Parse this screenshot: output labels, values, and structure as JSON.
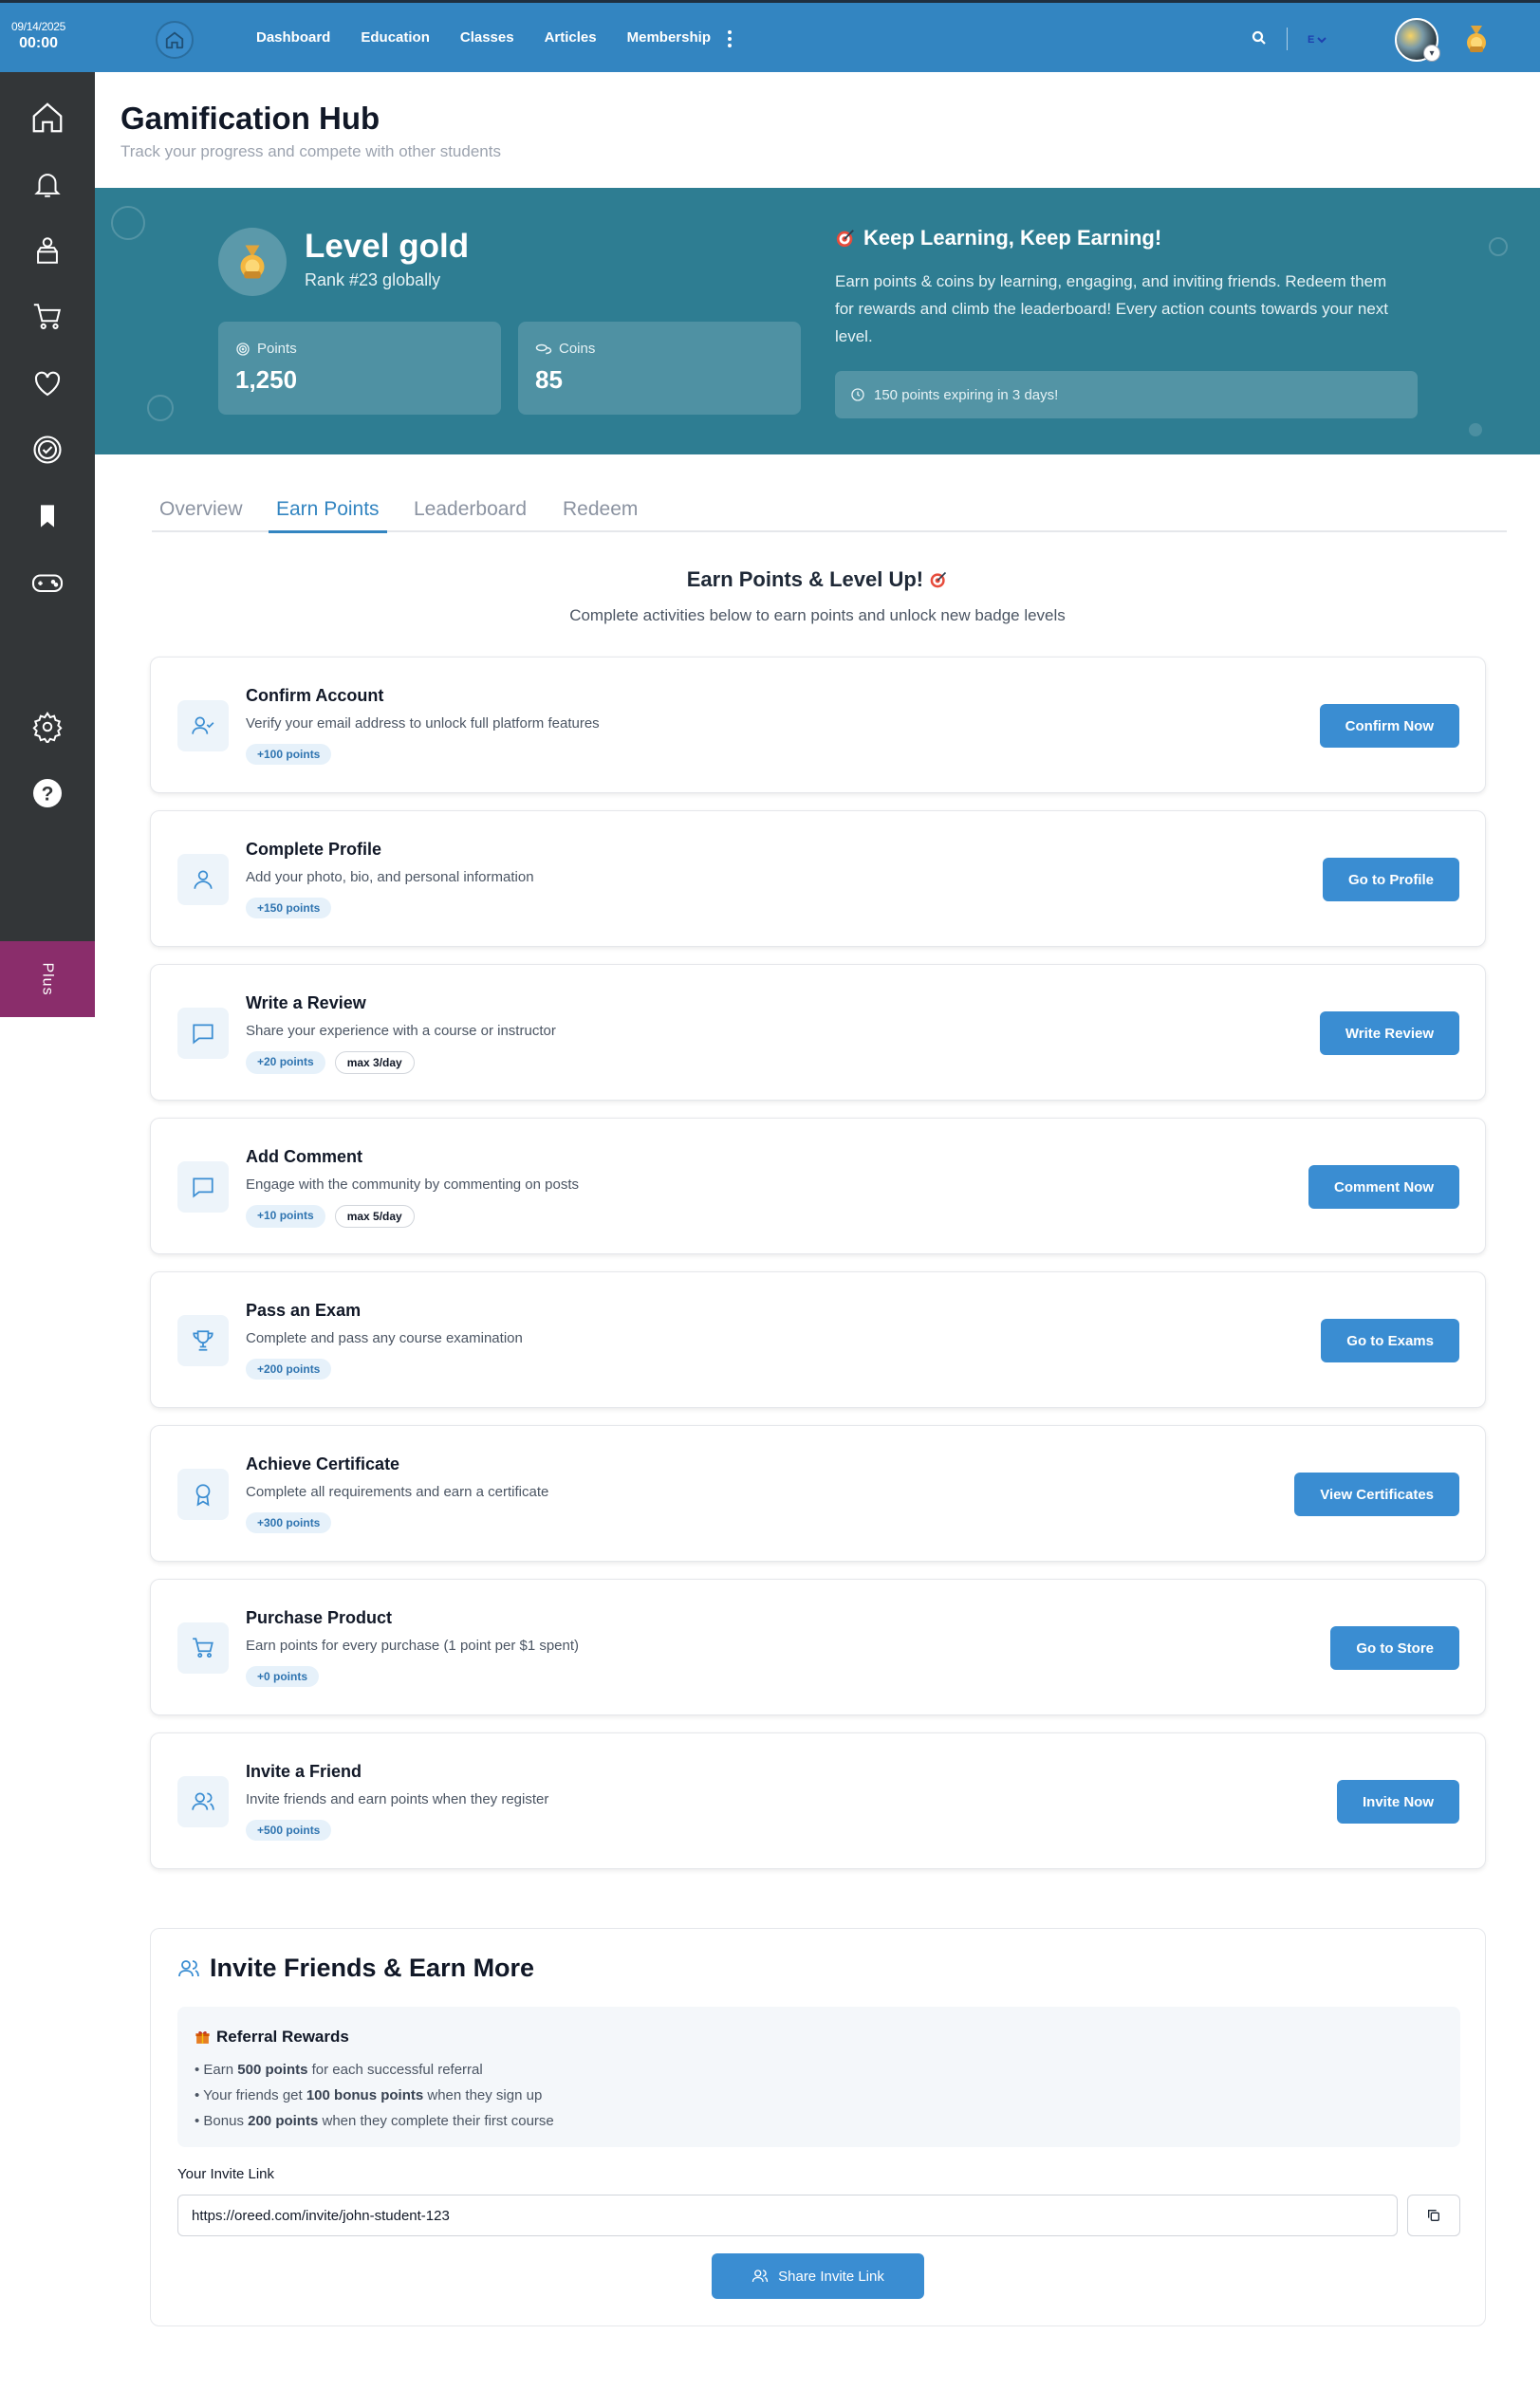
{
  "topbar": {
    "date": "09/14/2025",
    "time": "00:00",
    "nav": [
      "Dashboard",
      "Education",
      "Classes",
      "Articles",
      "Membership"
    ],
    "language": "E"
  },
  "sidebar": {
    "items": [
      "home-icon",
      "bell-icon",
      "store-icon",
      "cart-icon",
      "heart-icon",
      "badge-check-icon",
      "bookmark-icon",
      "gamepad-icon",
      "settings-icon",
      "help-icon"
    ],
    "plus_label": "Plus"
  },
  "header": {
    "title": "Gamification Hub",
    "subtitle": "Track your progress and compete with other students"
  },
  "hero": {
    "level_title": "Level gold",
    "rank": "Rank #23 globally",
    "points_label": "Points",
    "points_value": "1,250",
    "coins_label": "Coins",
    "coins_value": "85",
    "keep_title": "Keep Learning, Keep Earning!",
    "keep_text": "Earn points & coins by learning, engaging, and inviting friends. Redeem them for rewards and climb the leaderboard! Every action counts towards your next level.",
    "expiring": "150 points expiring in 3 days!"
  },
  "tabs": [
    "Overview",
    "Earn Points",
    "Leaderboard",
    "Redeem"
  ],
  "active_tab": "Earn Points",
  "earn": {
    "title": "Earn Points & Level Up!",
    "subtitle": "Complete activities below to earn points and unlock new badge levels",
    "activities": [
      {
        "title": "Confirm Account",
        "desc": "Verify your email address to unlock full platform features",
        "points": "+100 points",
        "limit": "",
        "button": "Confirm Now",
        "icon": "user-check-icon"
      },
      {
        "title": "Complete Profile",
        "desc": "Add your photo, bio, and personal information",
        "points": "+150 points",
        "limit": "",
        "button": "Go to Profile",
        "icon": "user-icon"
      },
      {
        "title": "Write a Review",
        "desc": "Share your experience with a course or instructor",
        "points": "+20 points",
        "limit": "max 3/day",
        "button": "Write Review",
        "icon": "message-square-icon"
      },
      {
        "title": "Add Comment",
        "desc": "Engage with the community by commenting on posts",
        "points": "+10 points",
        "limit": "max 5/day",
        "button": "Comment Now",
        "icon": "message-square-icon"
      },
      {
        "title": "Pass an Exam",
        "desc": "Complete and pass any course examination",
        "points": "+200 points",
        "limit": "",
        "button": "Go to Exams",
        "icon": "trophy-icon"
      },
      {
        "title": "Achieve Certificate",
        "desc": "Complete all requirements and earn a certificate",
        "points": "+300 points",
        "limit": "",
        "button": "View Certificates",
        "icon": "award-icon"
      },
      {
        "title": "Purchase Product",
        "desc": "Earn points for every purchase (1 point per $1 spent)",
        "points": "+0 points",
        "limit": "",
        "button": "Go to Store",
        "icon": "shopping-cart-icon"
      },
      {
        "title": "Invite a Friend",
        "desc": "Invite friends and earn points when they register",
        "points": "+500 points",
        "limit": "",
        "button": "Invite Now",
        "icon": "users-icon"
      }
    ]
  },
  "invite": {
    "title": "Invite Friends & Earn More",
    "rewards_title": "Referral Rewards",
    "r1_pre": "• Earn ",
    "r1_bold": "500 points",
    "r1_post": " for each successful referral",
    "r2_pre": "• Your friends get ",
    "r2_bold": "100 bonus points",
    "r2_post": " when they sign up",
    "r3_pre": "• Bonus ",
    "r3_bold": "200 points",
    "r3_post": " when they complete their first course",
    "link_label": "Your Invite Link",
    "link_value": "https://oreed.com/invite/john-student-123",
    "share_label": "Share Invite Link"
  },
  "colors": {
    "topbar": "#3385c1",
    "sidebar": "#333638",
    "hero": "#2e7d92",
    "accent": "#3a8dd2",
    "plus": "#8a2d6b"
  }
}
